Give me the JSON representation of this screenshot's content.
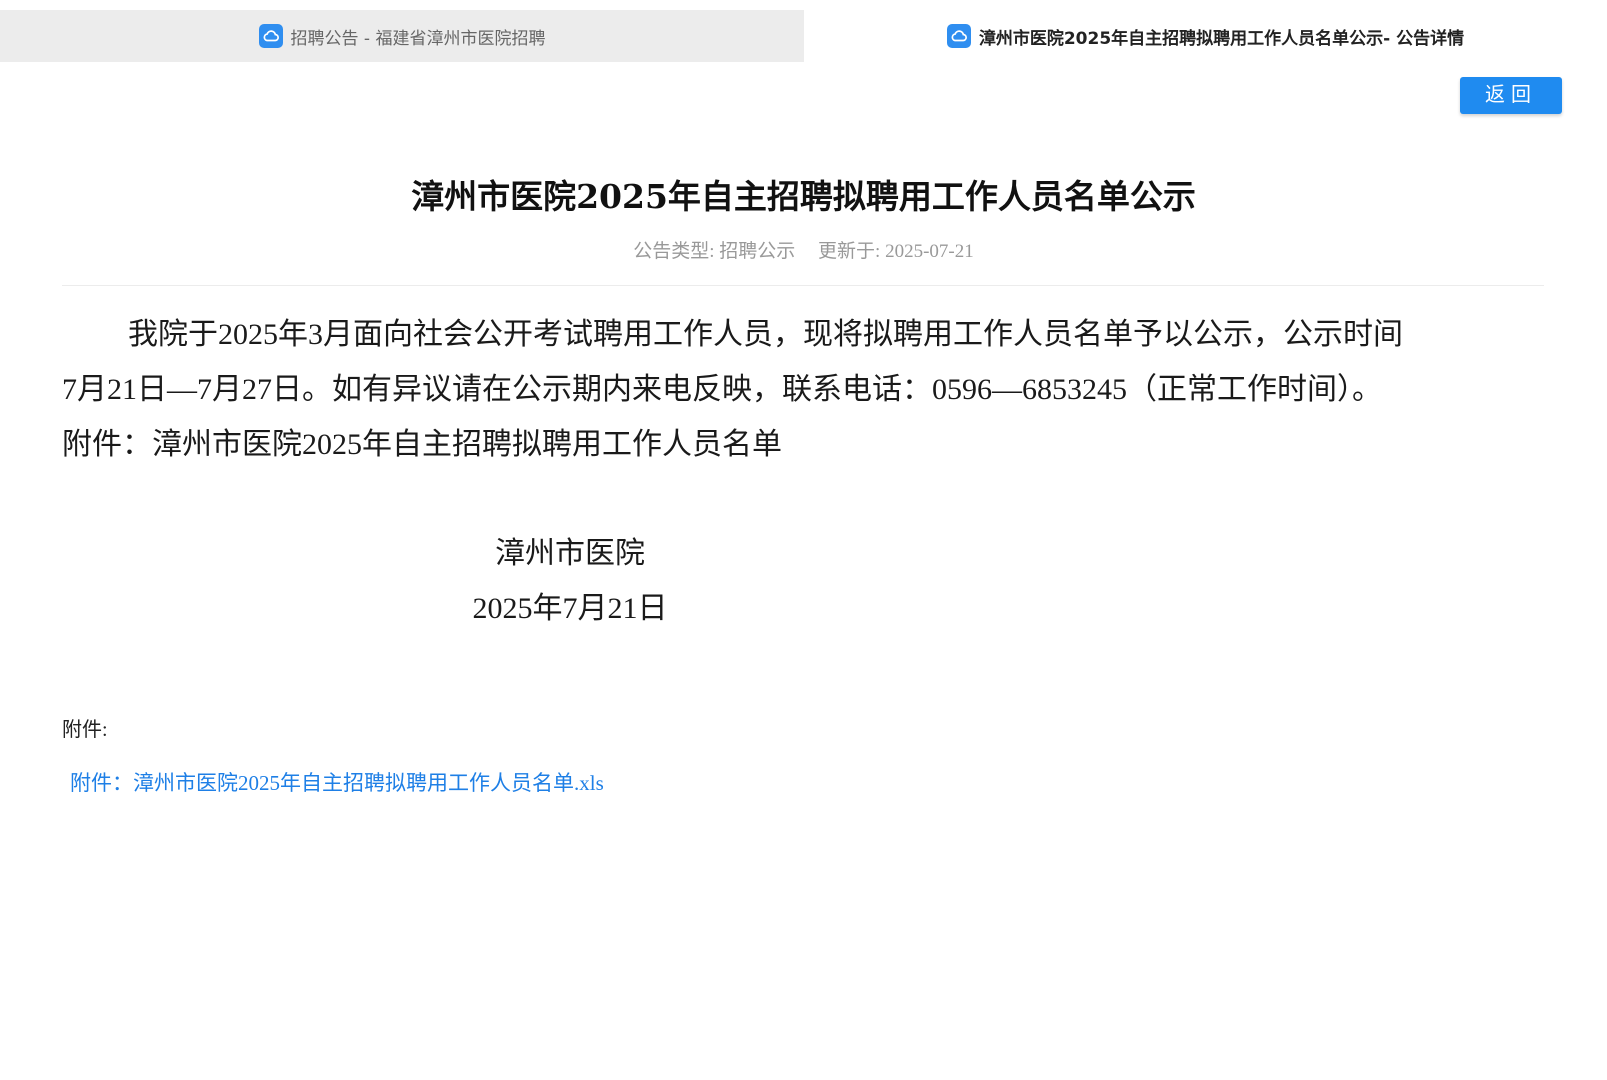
{
  "tabs": [
    {
      "label": "招聘公告 - 福建省漳州市医院招聘",
      "active": false
    },
    {
      "label": "漳州市医院2025年自主招聘拟聘用工作人员名单公示- 公告详情",
      "active": true
    }
  ],
  "icons": {
    "tab": "cloud-icon",
    "close": "close-icon"
  },
  "colors": {
    "accent": "#1f8bf0",
    "link": "#1e7fe6",
    "meta": "#999999"
  },
  "toolbar": {
    "back_label": "返回"
  },
  "article": {
    "title": "漳州市医院2025年自主招聘拟聘用工作人员名单公示",
    "type_label": "公告类型: 招聘公示",
    "updated_label": "更新于: 2025-07-21",
    "paragraph_lines": [
      "我院于2025年3月面向社会公开考试聘用工作人员，现将拟聘用工作人员名单予以公示，公示时间",
      "7月21日—7月27日。如有异议请在公示期内来电反映，联系电话：0596—6853245（正常工作时间）。"
    ],
    "attachment_line": "附件：漳州市医院2025年自主招聘拟聘用工作人员名单",
    "signature_org": "漳州市医院",
    "signature_date": "2025年7月21日"
  },
  "attachments": {
    "label": "附件:",
    "items": [
      {
        "text": "附件：漳州市医院2025年自主招聘拟聘用工作人员名单.xls"
      }
    ]
  }
}
